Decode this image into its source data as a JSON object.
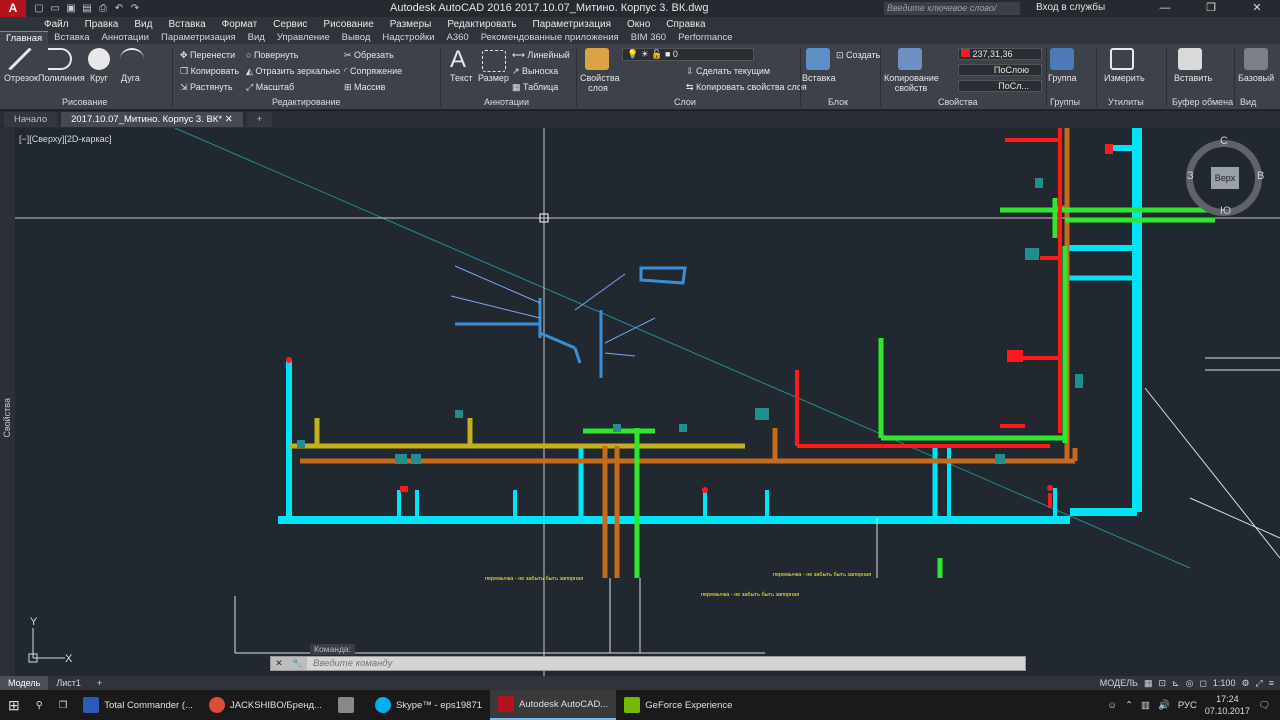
{
  "titlebar": {
    "logo": "A",
    "title": "Autodesk AutoCAD 2016    2017.10.07_Митино. Корпус 3. ВК.dwg",
    "search_placeholder": "Введите ключевое слово/фразу",
    "signin": "Вход в службы"
  },
  "menubar": [
    "Файл",
    "Правка",
    "Вид",
    "Вставка",
    "Формат",
    "Сервис",
    "Рисование",
    "Размеры",
    "Редактировать",
    "Параметризация",
    "Окно",
    "Справка"
  ],
  "ribbon_tabs": [
    "Главная",
    "Вставка",
    "Аннотации",
    "Параметризация",
    "Вид",
    "Управление",
    "Вывод",
    "Надстройки",
    "A360",
    "Рекомендованные приложения",
    "BIM 360",
    "Performance"
  ],
  "ribbon": {
    "draw": {
      "title": "Рисование",
      "items": [
        "Отрезок",
        "Полилиния",
        "Круг",
        "Дуга"
      ]
    },
    "modify": {
      "title": "Редактирование",
      "items": [
        "Перенести",
        "Повернуть",
        "Обрезать",
        "Копировать",
        "Отразить зеркально",
        "Сопряжение",
        "Растянуть",
        "Масштаб",
        "Массив"
      ]
    },
    "annotation": {
      "title": "Аннотации",
      "items": [
        "Текст",
        "Размер",
        "Линейный",
        "Выноска",
        "Таблица"
      ]
    },
    "layers": {
      "title": "Слои",
      "items": [
        "Свойства слоя",
        "Сделать текущим",
        "Копировать свойства слоя"
      ],
      "current_layer": "0"
    },
    "block": {
      "title": "Блок",
      "items": [
        "Вставка",
        "Создать"
      ]
    },
    "properties": {
      "title": "Свойства",
      "items": [
        "Копирование свойств"
      ],
      "color": "237,31,36",
      "linetype1": "ПоСлою",
      "linetype2": "ПоСл..."
    },
    "groups": {
      "title": "Группы",
      "items": [
        "Группа"
      ]
    },
    "utilities": {
      "title": "Утилиты",
      "items": [
        "Измерить"
      ]
    },
    "clipboard": {
      "title": "Буфер обмена",
      "items": [
        "Вставить"
      ]
    },
    "view": {
      "title": "Вид",
      "items": [
        "Базовый"
      ]
    }
  },
  "doc_tabs": [
    "Начало",
    "2017.10.07_Митино. Корпус 3. ВК*"
  ],
  "viewport_label": "[−][Сверху][2D-каркас]",
  "left_panel": "Свойства",
  "navcube": {
    "top": "Верх",
    "north": "С",
    "south": "Ю",
    "east": "В",
    "west": "З"
  },
  "drawing_labels": {
    "note1": "перемычка - не забыть быть запорная",
    "note2": "перемычка - не забыть быть запорная",
    "note3": "перемычка - не забыть быть запорная"
  },
  "command": {
    "label": "Команда:",
    "placeholder": "Введите команду"
  },
  "layout_tabs": [
    "Модель",
    "Лист1"
  ],
  "status": {
    "model": "МОДЕЛЬ",
    "scale": "1:100"
  },
  "taskbar": {
    "apps": [
      {
        "label": "Total Commander (...",
        "color": "#2b5bb8"
      },
      {
        "label": "JACKSHIBO/Бренд...",
        "color": "#dd4b39"
      },
      {
        "label": "",
        "color": "#888888"
      },
      {
        "label": "Skype™ - eps19871",
        "color": "#00aff0"
      },
      {
        "label": "Autodesk AutoCAD...",
        "color": "#b3141b"
      },
      {
        "label": "GeForce Experience",
        "color": "#76b900"
      }
    ],
    "lang": "РУС",
    "time": "17:24",
    "date": "07.10.2017"
  },
  "colors": {
    "cyan": "#00e5f5",
    "green": "#2ee82e",
    "orange": "#c76a1a",
    "red": "#ff1a1a",
    "olive": "#c2b11a",
    "teal": "#1f8f8f",
    "blue": "#3a8fd6"
  }
}
